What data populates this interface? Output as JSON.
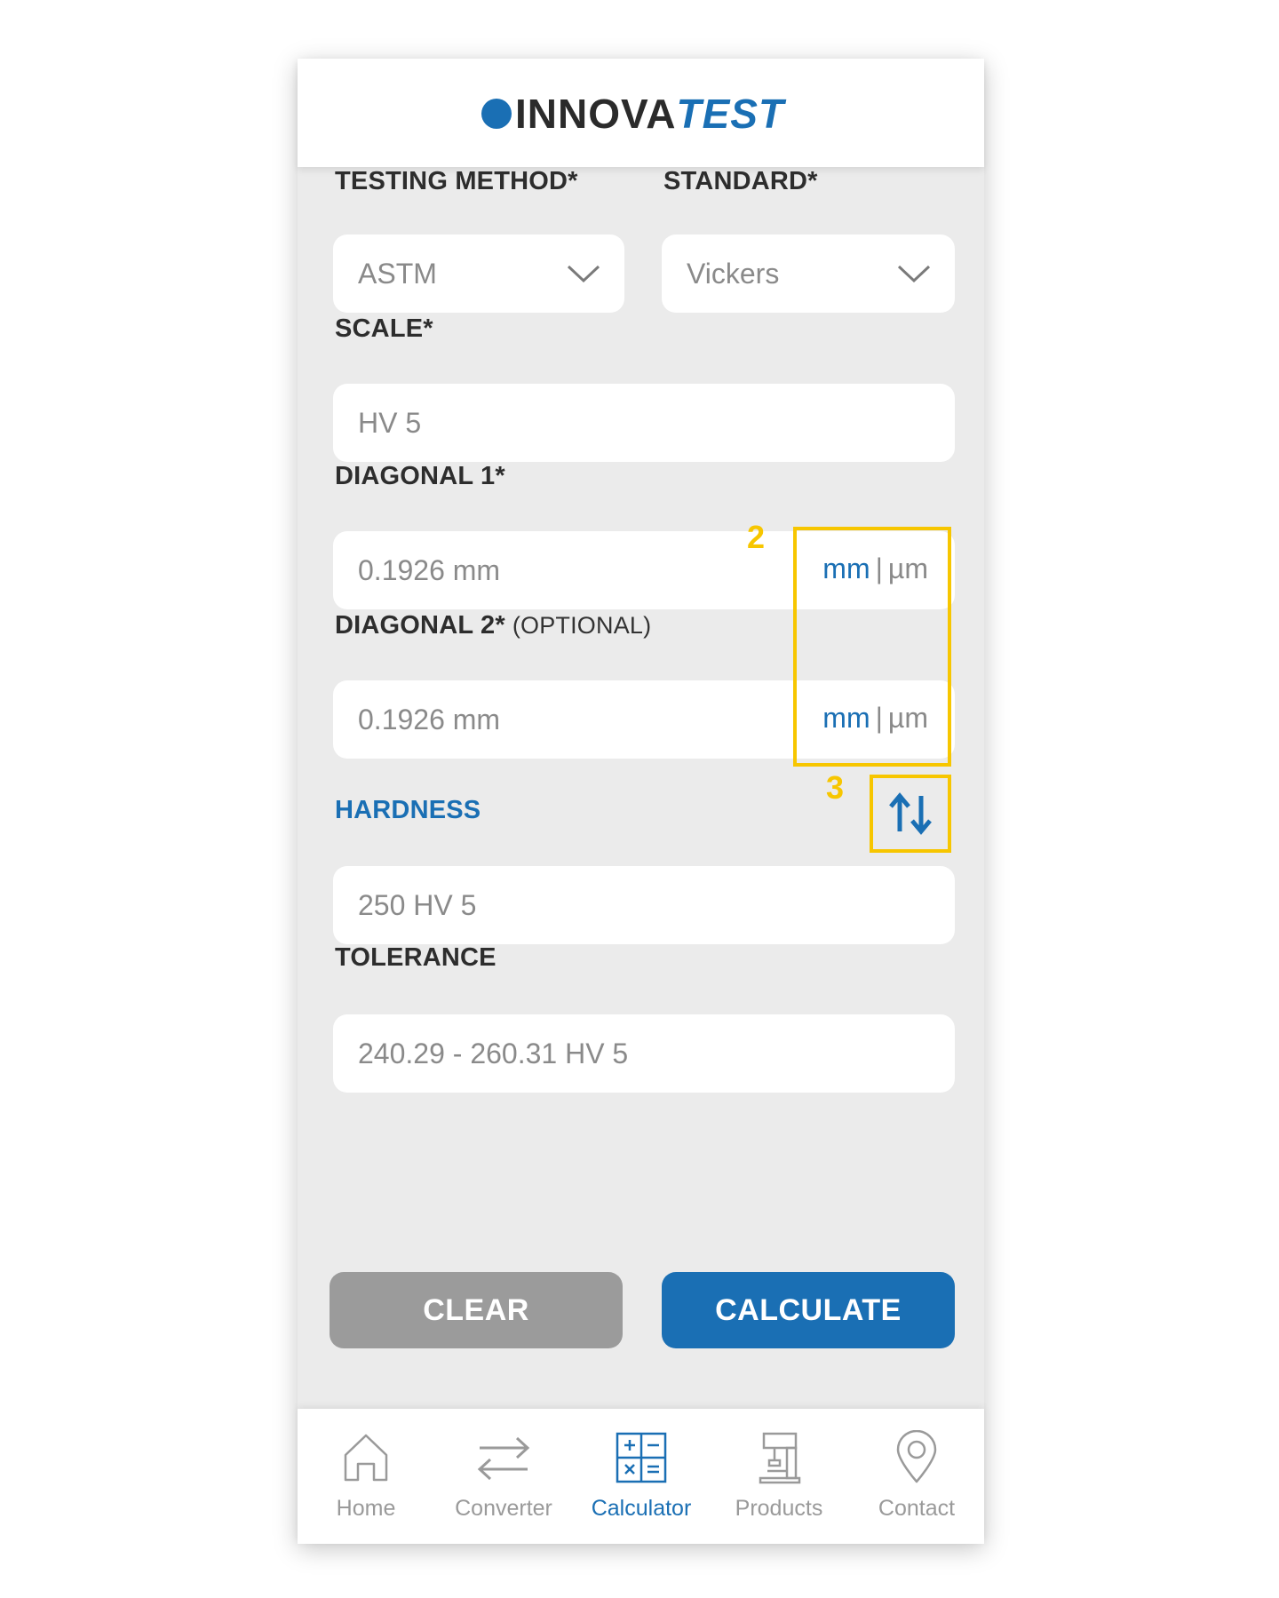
{
  "header": {
    "logo_text": "INNOVA",
    "logo_accent": "TEST"
  },
  "form": {
    "testing_method": {
      "label": "TESTING METHOD*",
      "value": "ASTM"
    },
    "standard": {
      "label": "STANDARD*",
      "value": "Vickers"
    },
    "scale": {
      "label": "SCALE*",
      "value": "HV 5"
    },
    "diagonal1": {
      "label": "DIAGONAL 1*",
      "value": "0.1926 mm",
      "unit_active": "mm",
      "unit_sep": "|",
      "unit_other": "µm"
    },
    "diagonal2": {
      "label": "DIAGONAL 2*",
      "label_optional": "(OPTIONAL)",
      "value": "0.1926 mm",
      "unit_active": "mm",
      "unit_sep": "|",
      "unit_other": "µm"
    },
    "hardness": {
      "label": "HARDNESS",
      "value": "250 HV 5"
    },
    "tolerance": {
      "label": "TOLERANCE",
      "value": "240.29 - 260.31 HV 5"
    }
  },
  "annotations": {
    "units_marker": "2",
    "swap_marker": "3"
  },
  "actions": {
    "clear_label": "CLEAR",
    "calculate_label": "CALCULATE"
  },
  "tabs": [
    {
      "label": "Home",
      "icon": "home-icon"
    },
    {
      "label": "Converter",
      "icon": "arrows-swap-icon"
    },
    {
      "label": "Calculator",
      "icon": "calculator-icon"
    },
    {
      "label": "Products",
      "icon": "hardness-tester-icon"
    },
    {
      "label": "Contact",
      "icon": "location-pin-icon"
    }
  ],
  "colors": {
    "accent": "#1a6fb4",
    "highlight": "#f7c600",
    "background": "#ebebeb",
    "clear_button": "#9b9b9b"
  }
}
